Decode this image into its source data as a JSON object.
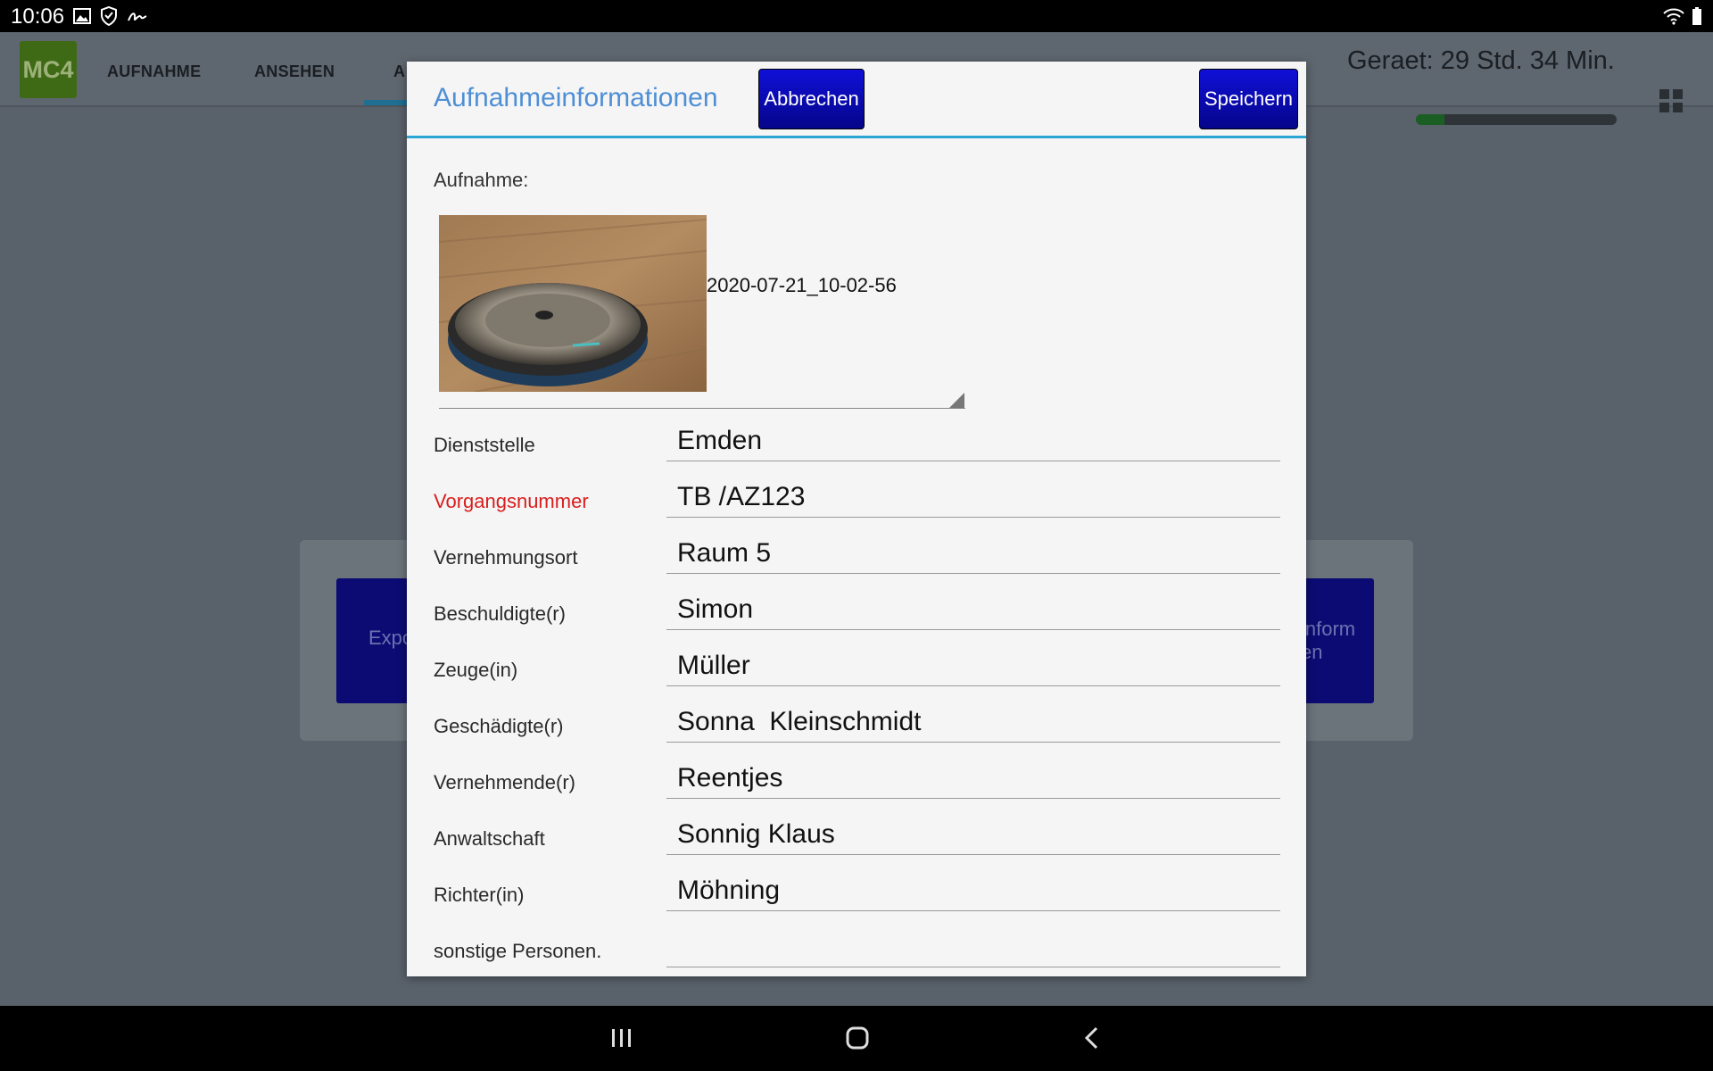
{
  "status_bar": {
    "time": "10:06"
  },
  "app_bar": {
    "logo": "MC4",
    "tabs": [
      "AUFNAHME",
      "ANSEHEN",
      "A"
    ],
    "device_time": "Geraet: 29 Std. 34 Min.",
    "device_usage_fraction": 0.14
  },
  "background": {
    "left_button": "Expo",
    "right_button_line1": "inform",
    "right_button_line2": "en"
  },
  "dialog": {
    "title": "Aufnahmeinformationen",
    "cancel_label": "Abbrechen",
    "save_label": "Speichern",
    "recording_label": "Aufnahme:",
    "recording_file": "2020-07-21_10-02-56",
    "fields": [
      {
        "label": "Dienststelle",
        "value": "Emden",
        "required": false
      },
      {
        "label": "Vorgangsnummer",
        "value": "TB /AZ123",
        "required": true
      },
      {
        "label": "Vernehmungsort",
        "value": "Raum 5",
        "required": false
      },
      {
        "label": "Beschuldigte(r)",
        "value": "Simon",
        "required": false
      },
      {
        "label": "Zeuge(in)",
        "value": "Müller",
        "required": false
      },
      {
        "label": "Geschädigte(r)",
        "value": "Sonna  Kleinschmidt",
        "required": false
      },
      {
        "label": "Vernehmende(r)",
        "value": "Reentjes",
        "required": false
      },
      {
        "label": "Anwaltschaft",
        "value": "Sonnig Klaus",
        "required": false
      },
      {
        "label": "Richter(in)",
        "value": "Möhning",
        "required": false
      },
      {
        "label": "sonstige Personen.",
        "value": "",
        "required": false
      }
    ]
  },
  "colors": {
    "accent": "#2ba5d4",
    "button": "#0a0ae0",
    "required": "#d81e1e",
    "title": "#4e8fd5"
  }
}
